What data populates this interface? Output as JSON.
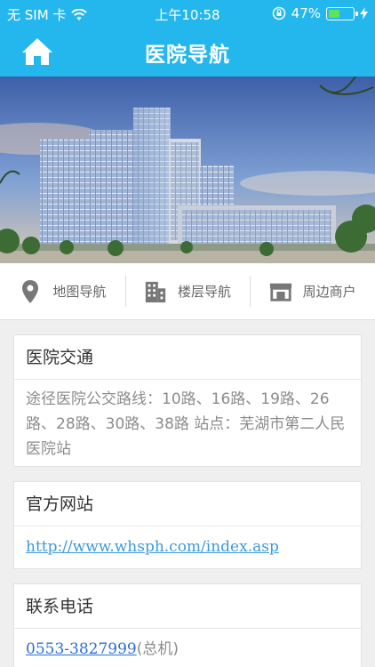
{
  "status_bar": {
    "carrier": "无 SIM 卡",
    "time": "上午10:58",
    "battery_percent_text": "47%",
    "battery_level": 0.47
  },
  "nav": {
    "title": "医院导航"
  },
  "quick_nav": [
    {
      "label": "地图导航",
      "icon": "map-pin-icon"
    },
    {
      "label": "楼层导航",
      "icon": "building-icon"
    },
    {
      "label": "周边商户",
      "icon": "storefront-icon"
    }
  ],
  "cards": {
    "transport": {
      "title": "医院交通",
      "body": "途径医院公交路线：10路、16路、19路、26路、28路、30路、38路 站点：芜湖市第二人民医院站"
    },
    "website": {
      "title": "官方网站",
      "url": "http://www.whsph.com/index.asp"
    },
    "phone": {
      "title": "联系电话",
      "number": "0553-3827999",
      "note": "(总机)"
    }
  },
  "colors": {
    "brand": "#24b7ee",
    "link": "#2a6fd8"
  }
}
